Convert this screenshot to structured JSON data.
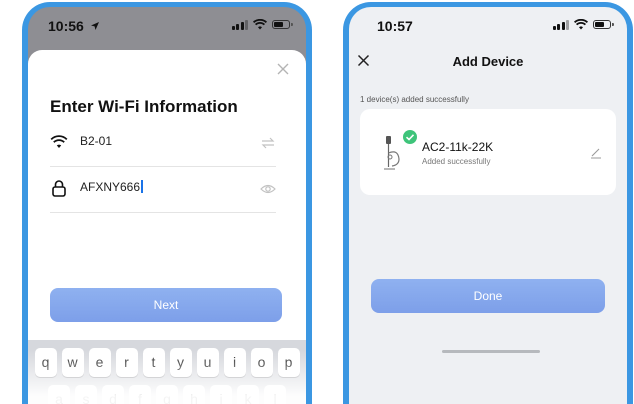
{
  "left_screen": {
    "status_time": "10:56",
    "title": "Enter Wi-Fi Information",
    "wifi_ssid": "B2-01",
    "wifi_password": "AFXNY666",
    "next_label": "Next",
    "keyboard_row1": [
      "q",
      "w",
      "e",
      "r",
      "t",
      "y",
      "u",
      "i",
      "o",
      "p"
    ],
    "keyboard_row2": [
      "a",
      "s",
      "d",
      "f",
      "g",
      "h",
      "j",
      "k",
      "l"
    ]
  },
  "right_screen": {
    "status_time": "10:57",
    "title": "Add Device",
    "subtitle": "1 device(s) added successfully",
    "device_name": "AC2-11k-22K",
    "device_status": "Added successfully",
    "done_label": "Done"
  },
  "colors": {
    "frame": "#3b97e2",
    "primary_button": "#7d9fe9",
    "success_check": "#3ec47a"
  },
  "icons": [
    "location-arrow-icon",
    "signal-icon",
    "wifi-icon",
    "battery-icon",
    "close-icon",
    "lock-icon",
    "swap-icon",
    "eye-icon",
    "device-icon",
    "check-icon",
    "edit-icon"
  ]
}
